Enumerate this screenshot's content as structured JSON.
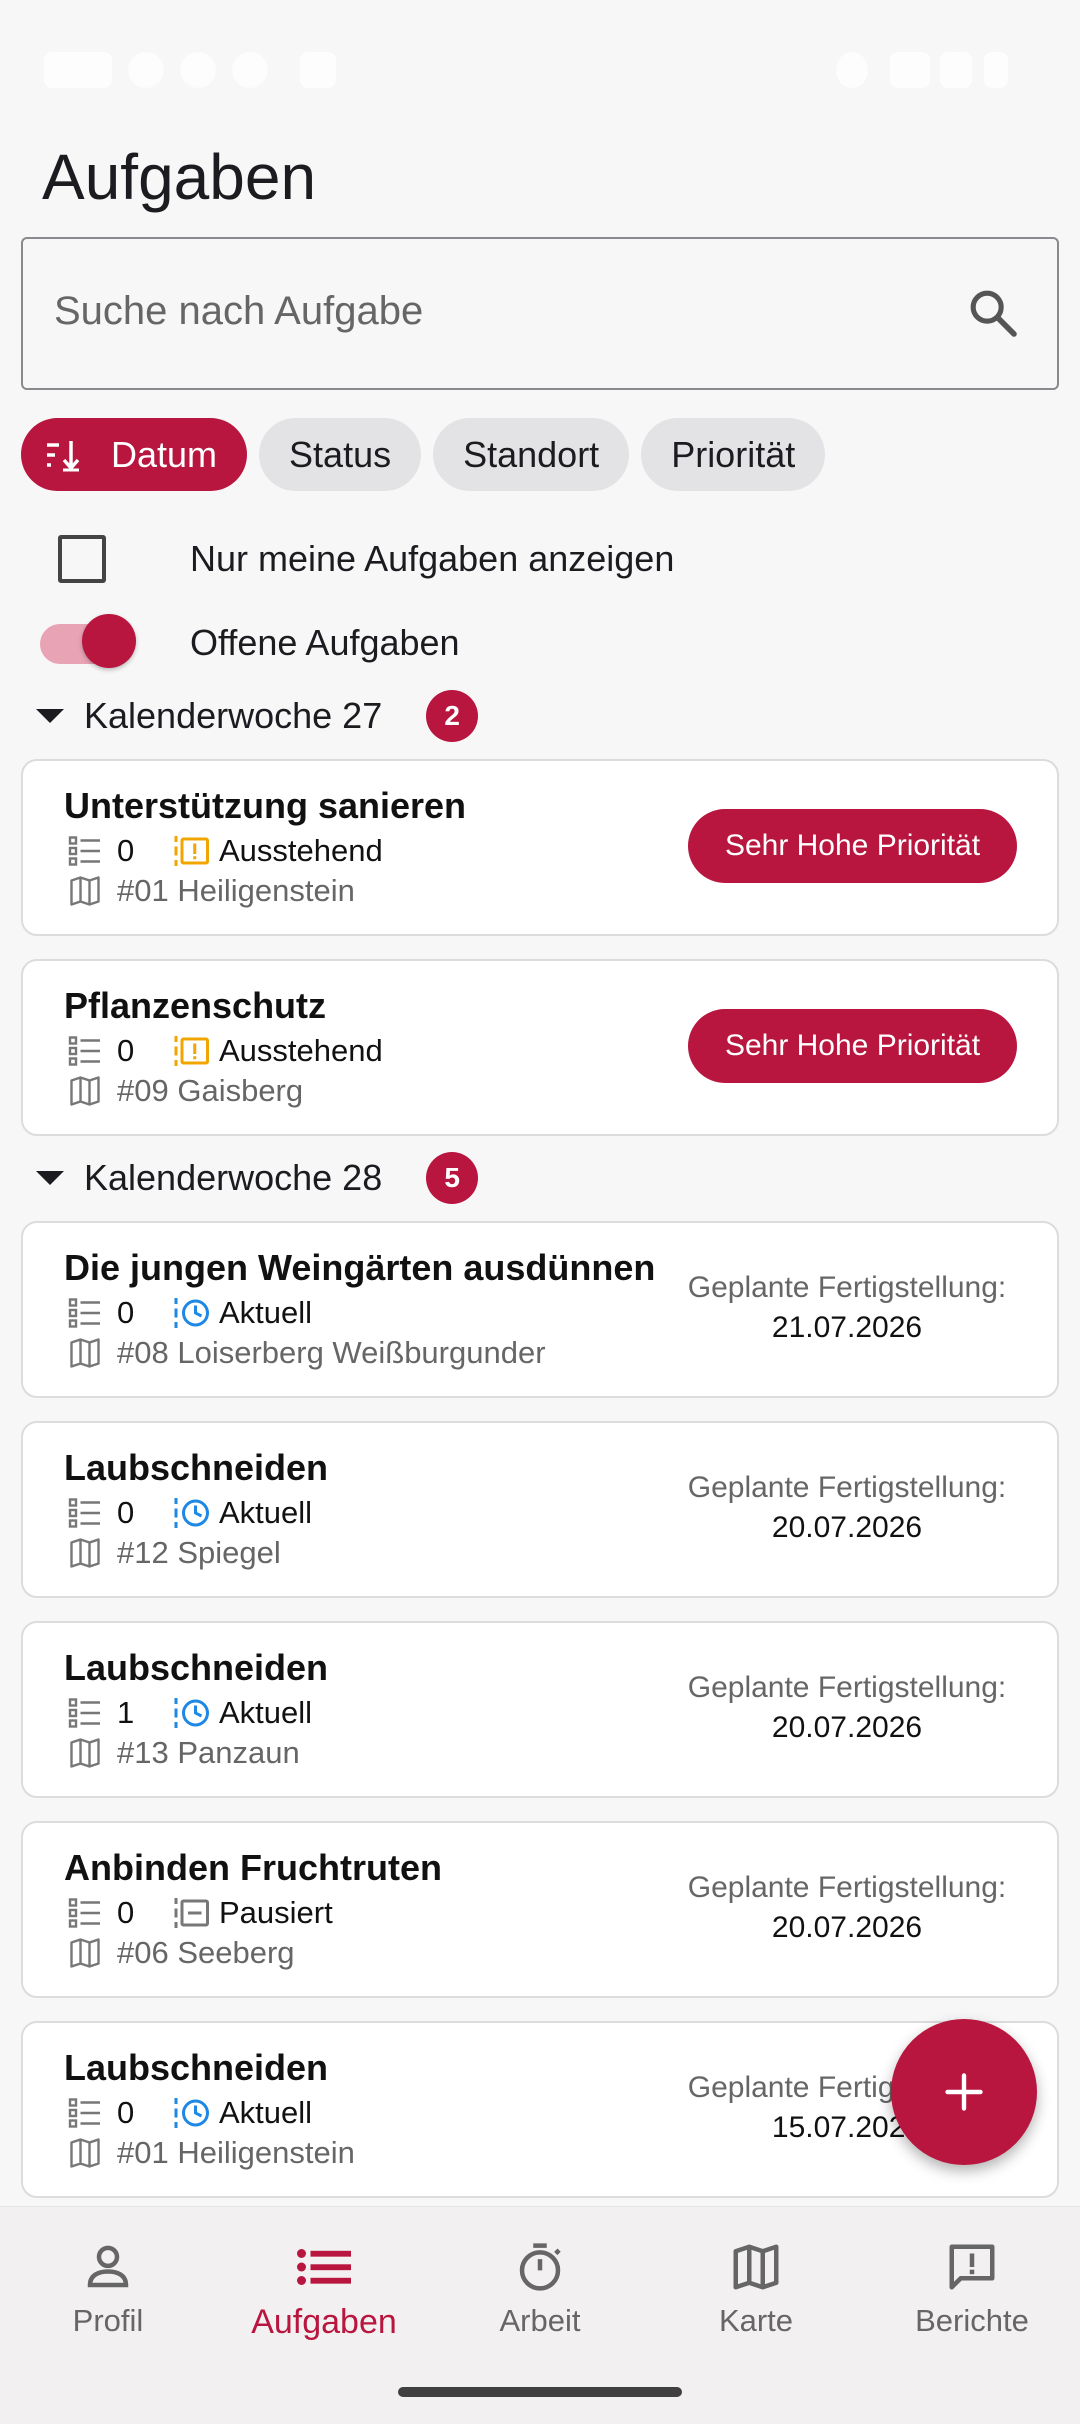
{
  "header": {
    "title": "Aufgaben"
  },
  "search": {
    "placeholder": "Suche nach Aufgabe"
  },
  "sort_chips": [
    {
      "label": "Datum",
      "active": true
    },
    {
      "label": "Status",
      "active": false
    },
    {
      "label": "Standort",
      "active": false
    },
    {
      "label": "Priorität",
      "active": false
    }
  ],
  "filters": {
    "only_mine_label": "Nur meine Aufgaben anzeigen",
    "only_mine_checked": false,
    "open_tasks_label": "Offene Aufgaben",
    "open_tasks_on": true
  },
  "groups": [
    {
      "label": "Kalenderwoche 27",
      "count": "2",
      "tasks": [
        {
          "title": "Unterstützung sanieren",
          "subtasks": "0",
          "status": "Ausstehend",
          "status_icon": "pending-icon",
          "location": "#01 Heiligenstein",
          "priority": "Sehr Hohe Priorität"
        },
        {
          "title": "Pflanzenschutz",
          "subtasks": "0",
          "status": "Ausstehend",
          "status_icon": "pending-icon",
          "location": "#09 Gaisberg",
          "priority": "Sehr Hohe Priorität"
        }
      ]
    },
    {
      "label": "Kalenderwoche 28",
      "count": "5",
      "tasks": [
        {
          "title": "Die jungen Weingärten ausdünnen",
          "subtasks": "0",
          "status": "Aktuell",
          "status_icon": "clock-icon",
          "location": "#08 Loiserberg Weißburgunder",
          "planned_label": "Geplante Fertigstellung:",
          "planned_date": "21.07.2026"
        },
        {
          "title": "Laubschneiden",
          "subtasks": "0",
          "status": "Aktuell",
          "status_icon": "clock-icon",
          "location": "#12 Spiegel",
          "planned_label": "Geplante Fertigstellung:",
          "planned_date": "20.07.2026"
        },
        {
          "title": "Laubschneiden",
          "subtasks": "1",
          "status": "Aktuell",
          "status_icon": "clock-icon",
          "location": "#13 Panzaun",
          "planned_label": "Geplante Fertigstellung:",
          "planned_date": "20.07.2026"
        },
        {
          "title": "Anbinden Fruchtruten",
          "subtasks": "0",
          "status": "Pausiert",
          "status_icon": "paused-icon",
          "location": "#06 Seeberg",
          "planned_label": "Geplante Fertigstellung:",
          "planned_date": "20.07.2026"
        },
        {
          "title": "Laubschneiden",
          "subtasks": "0",
          "status": "Aktuell",
          "status_icon": "clock-icon",
          "location": "#01 Heiligenstein",
          "planned_label": "Geplante Fertigstellung:",
          "planned_date": "15.07.2026"
        }
      ]
    }
  ],
  "nav": [
    {
      "label": "Profil",
      "icon": "person-icon",
      "active": false
    },
    {
      "label": "Aufgaben",
      "icon": "list-icon",
      "active": true
    },
    {
      "label": "Arbeit",
      "icon": "timer-icon",
      "active": false
    },
    {
      "label": "Karte",
      "icon": "map-icon",
      "active": false
    },
    {
      "label": "Berichte",
      "icon": "report-icon",
      "active": false
    }
  ],
  "colors": {
    "accent": "#b8153f",
    "pending": "#f2a400",
    "active": "#1e88e5",
    "muted": "#666666"
  }
}
